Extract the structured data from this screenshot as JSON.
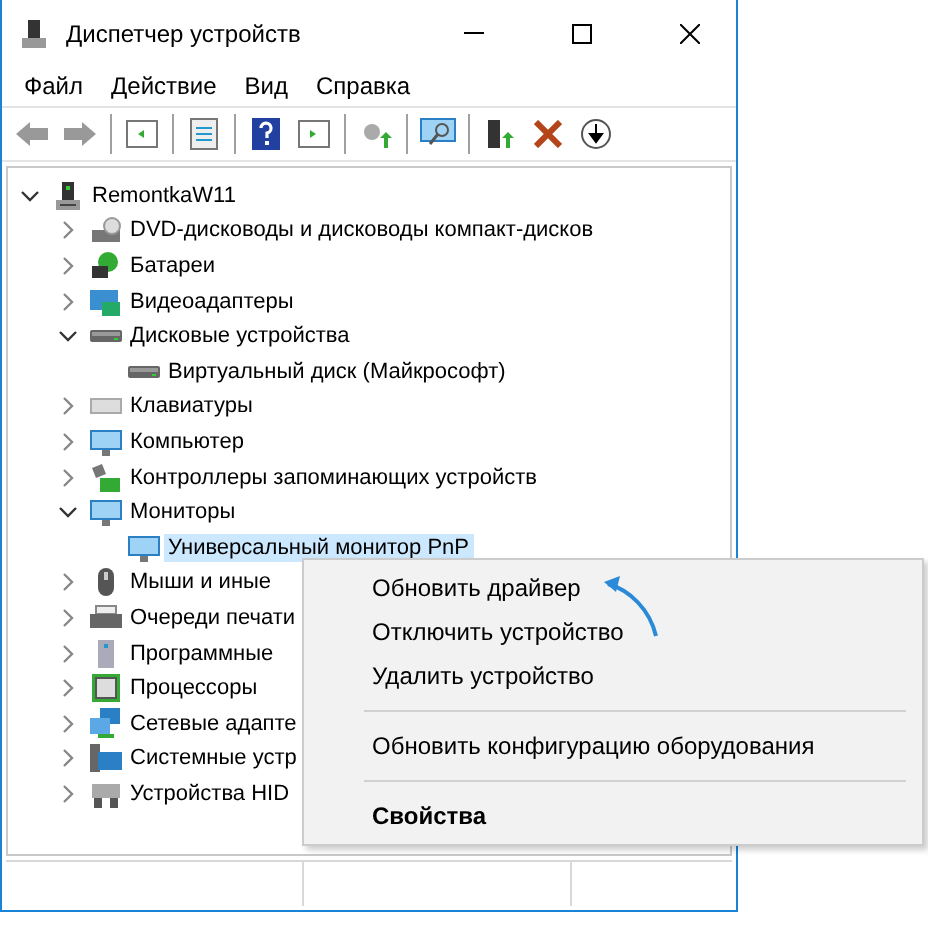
{
  "window": {
    "title": "Диспетчер устройств"
  },
  "menu": [
    "Файл",
    "Действие",
    "Вид",
    "Справка"
  ],
  "tree": [
    {
      "label": "RemontkaW11",
      "kind": "computer",
      "expanded": true,
      "selected": false,
      "children": [
        {
          "label": "DVD-дисководы и дисководы компакт-дисков",
          "kind": "dvd",
          "expanded": false,
          "selected": false
        },
        {
          "label": "Батареи",
          "kind": "battery",
          "expanded": false,
          "selected": false
        },
        {
          "label": "Видеоадаптеры",
          "kind": "video",
          "expanded": false,
          "selected": false
        },
        {
          "label": "Дисковые устройства",
          "kind": "disk",
          "expanded": true,
          "selected": false,
          "children": [
            {
              "label": "Виртуальный диск (Майкрософт)",
              "kind": "disk",
              "selected": false
            }
          ]
        },
        {
          "label": "Клавиатуры",
          "kind": "keyboard",
          "expanded": false,
          "selected": false
        },
        {
          "label": "Компьютер",
          "kind": "monitor",
          "expanded": false,
          "selected": false
        },
        {
          "label": "Контроллеры запоминающих устройств",
          "kind": "controller",
          "expanded": false,
          "selected": false
        },
        {
          "label": "Мониторы",
          "kind": "monitor",
          "expanded": true,
          "selected": false,
          "children": [
            {
              "label": "Универсальный монитор PnP",
              "kind": "monitor",
              "selected": true
            }
          ]
        },
        {
          "label": "Мыши и иные",
          "kind": "mouse",
          "expanded": false,
          "selected": false
        },
        {
          "label": "Очереди печати",
          "kind": "printer",
          "expanded": false,
          "selected": false
        },
        {
          "label": "Программные",
          "kind": "software",
          "expanded": false,
          "selected": false
        },
        {
          "label": "Процессоры",
          "kind": "cpu",
          "expanded": false,
          "selected": false
        },
        {
          "label": "Сетевые адапте",
          "kind": "network",
          "expanded": false,
          "selected": false
        },
        {
          "label": "Системные устр",
          "kind": "system",
          "expanded": false,
          "selected": false
        },
        {
          "label": "Устройства HID",
          "kind": "hid",
          "expanded": false,
          "selected": false
        }
      ]
    }
  ],
  "context_menu": [
    {
      "label": "Обновить драйвер",
      "kind": "item",
      "bold": false
    },
    {
      "label": "Отключить устройство",
      "kind": "item",
      "bold": false
    },
    {
      "label": "Удалить устройство",
      "kind": "item",
      "bold": false
    },
    {
      "kind": "separator"
    },
    {
      "label": "Обновить конфигурацию оборудования",
      "kind": "item",
      "bold": false
    },
    {
      "kind": "separator"
    },
    {
      "label": "Свойства",
      "kind": "item",
      "bold": true
    }
  ]
}
